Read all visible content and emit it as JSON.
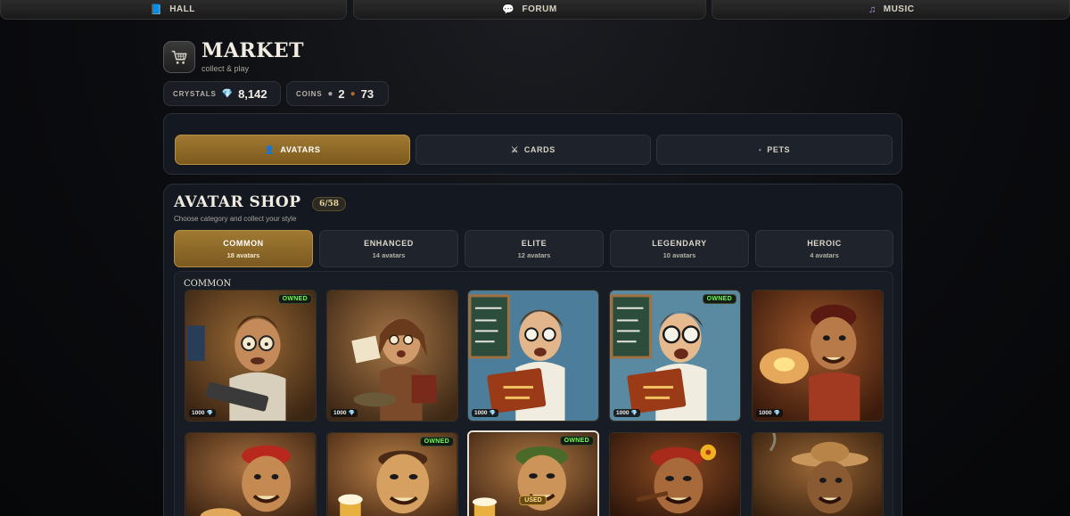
{
  "nav": {
    "hall": {
      "label": "HALL",
      "icon": "book-icon"
    },
    "forum": {
      "label": "FORUM",
      "icon": "speech-bubble-icon"
    },
    "music": {
      "label": "MUSIC",
      "icon": "music-note-icon"
    }
  },
  "header": {
    "title": "MARKET",
    "subtitle": "collect & play",
    "icon": "cart-icon"
  },
  "stats": {
    "crystals": {
      "label": "CRYSTALS",
      "value": "8,142",
      "icon": "gem-icon"
    },
    "coins": {
      "label": "COINS",
      "silver": "2",
      "bronze": "73",
      "icons": [
        "silver-coin-icon",
        "bronze-coin-icon"
      ]
    }
  },
  "tabs": [
    {
      "label": "AVATARS",
      "icon": "person-icon",
      "active": true
    },
    {
      "label": "CARDS",
      "icon": "crossed-swords-icon",
      "active": false
    },
    {
      "label": "PETS",
      "icon": "paw-icon",
      "active": false
    }
  ],
  "shop": {
    "title": "AVATAR SHOP",
    "count": "6/58",
    "subtitle": "Choose category and collect your style",
    "section_label": "COMMON",
    "categories": [
      {
        "name": "COMMON",
        "count": "18 avatars",
        "active": true
      },
      {
        "name": "ENHANCED",
        "count": "14 avatars",
        "active": false
      },
      {
        "name": "ELITE",
        "count": "12 avatars",
        "active": false
      },
      {
        "name": "LEGENDARY",
        "count": "10 avatars",
        "active": false
      },
      {
        "name": "HEROIC",
        "count": "4 avatars",
        "active": false
      }
    ],
    "badges": {
      "owned": "OWNED",
      "used": "USED"
    },
    "avatars": [
      {
        "theme": "programmer",
        "owned": true,
        "price": "1000"
      },
      {
        "theme": "student-notes",
        "owned": false,
        "price": "1000"
      },
      {
        "theme": "oxford-reader-glasses",
        "owned": false,
        "price": "1000"
      },
      {
        "theme": "oxford-reader-round",
        "owned": true,
        "price": "1000"
      },
      {
        "theme": "pie-eater",
        "owned": false,
        "price": "1000"
      },
      {
        "theme": "pirate-bandana",
        "owned": false
      },
      {
        "theme": "beer-drinker",
        "owned": true
      },
      {
        "theme": "green-cap-beer",
        "owned": true,
        "used": true
      },
      {
        "theme": "flower-smoker",
        "owned": false
      },
      {
        "theme": "straw-hat-smoker",
        "owned": false
      }
    ]
  },
  "colors": {
    "accent_gold": "#a07a32",
    "owned_green": "#6bff4e",
    "panel": "#141820"
  }
}
